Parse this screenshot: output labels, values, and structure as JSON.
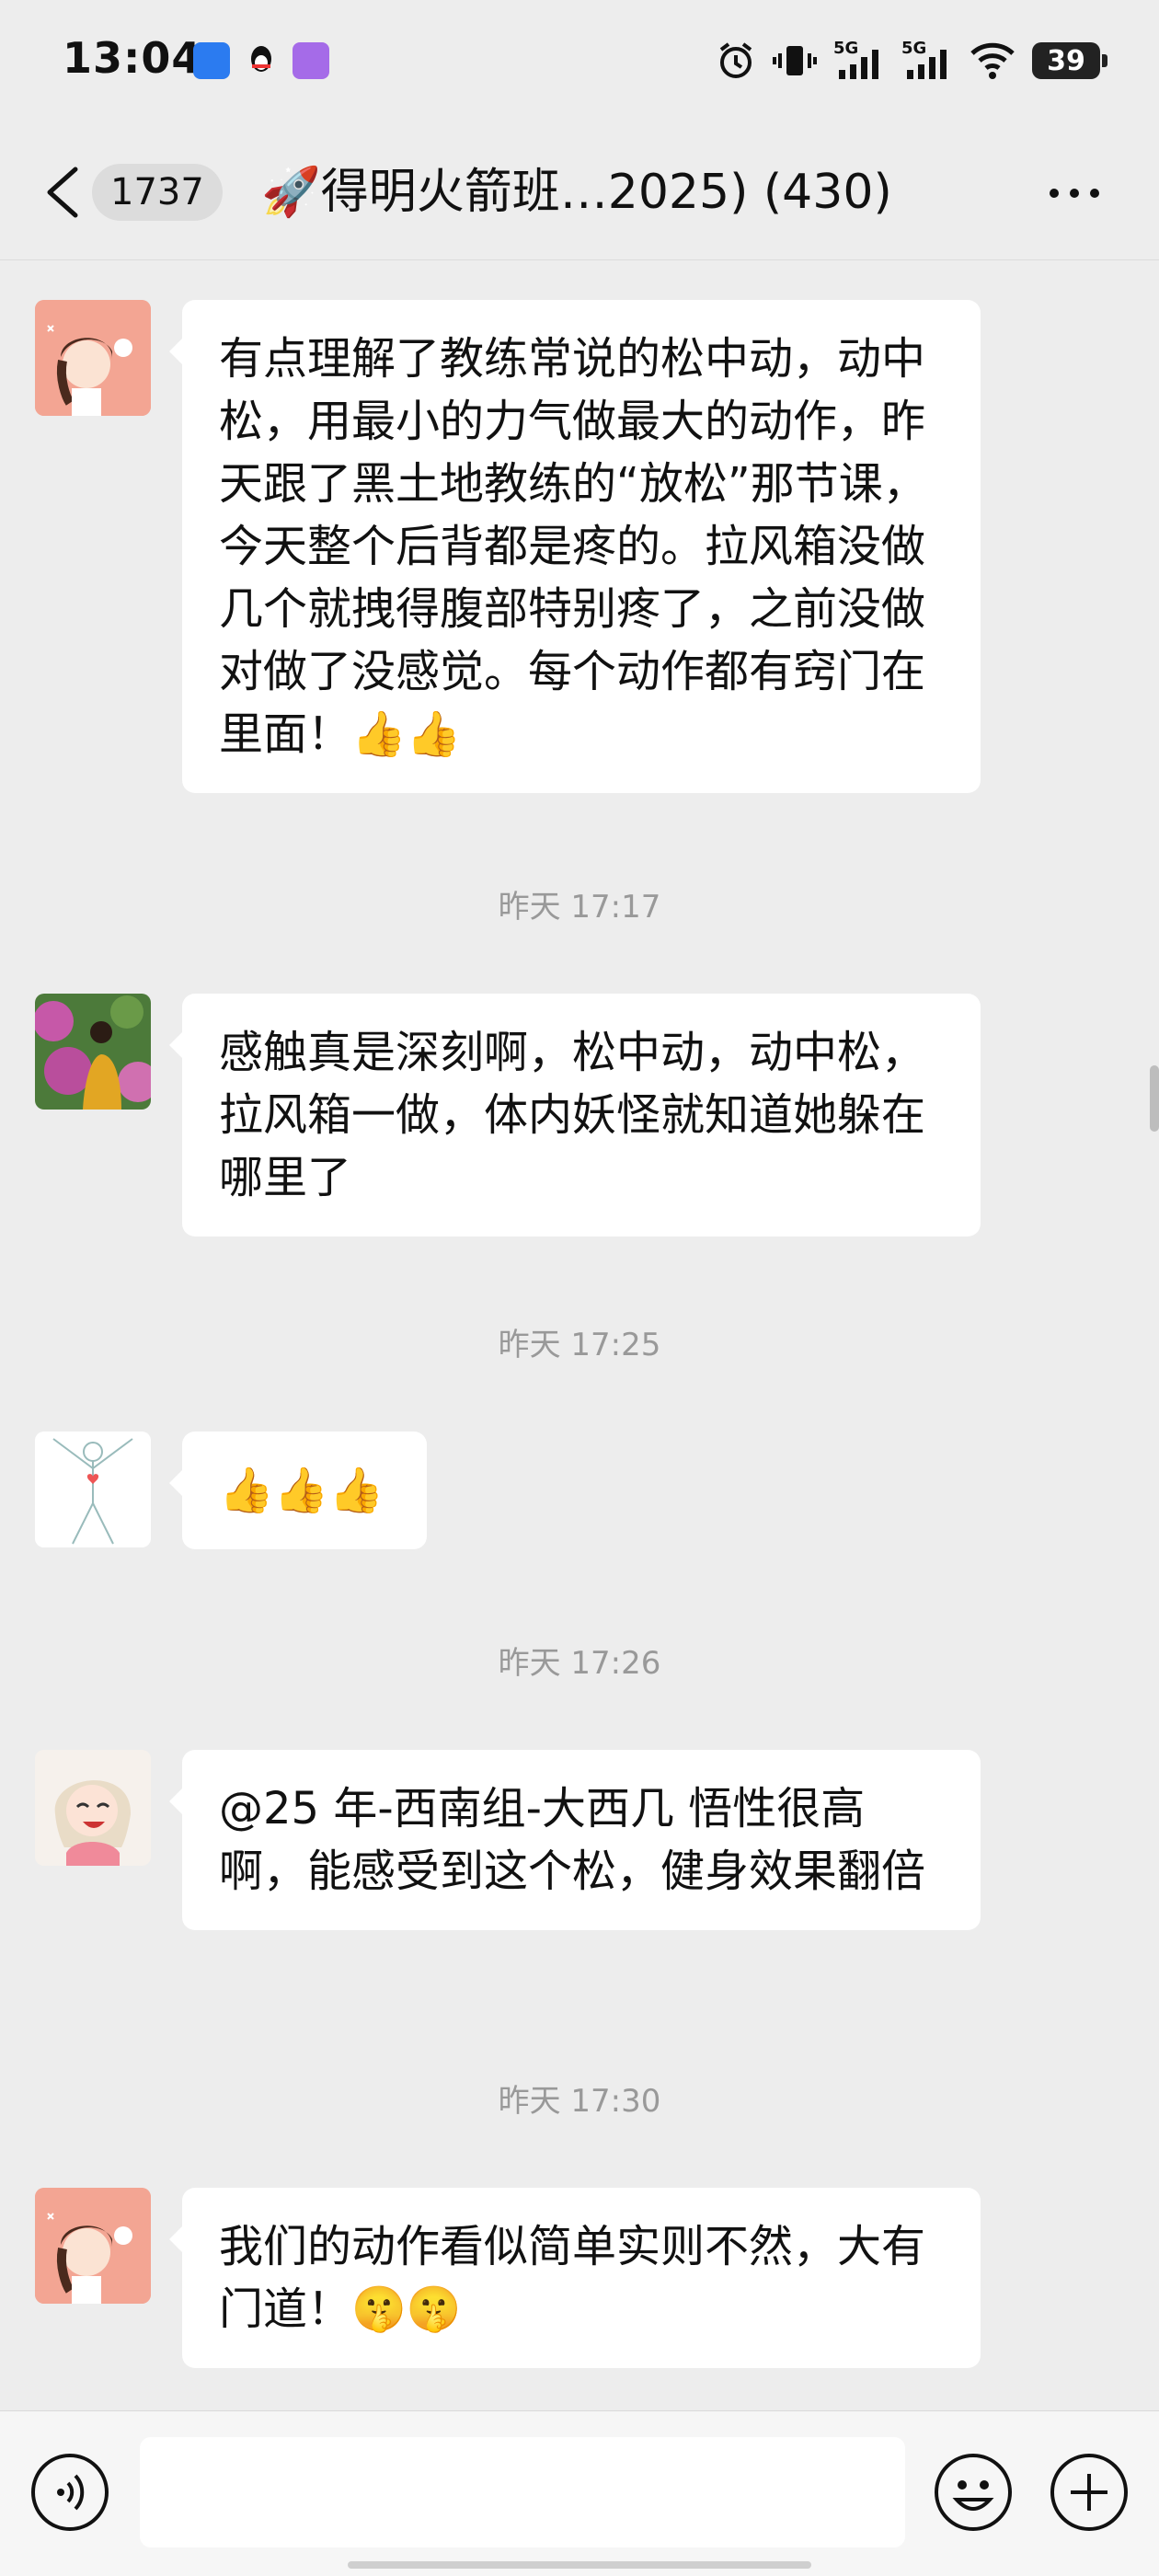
{
  "status_bar": {
    "time": "13:04",
    "app_icons": [
      "message-app-icon",
      "qq-icon",
      "app-icon"
    ],
    "network": [
      "5G",
      "5G"
    ],
    "battery": "39"
  },
  "nav": {
    "unread_count": "1737",
    "title": "🚀得明火箭班…2025) (430)"
  },
  "messages": [
    {
      "text": "有点理解了教练常说的松中动，动中松，用最小的力气做最大的动作，昨天跟了黑土地教练的“放松”那节课，今天整个后背都是疼的。拉风箱没做几个就拽得腹部特别疼了，之前没做对做了没感觉。每个动作都有窍门在里面！👍👍"
    },
    {
      "time": "昨天 17:17"
    },
    {
      "text": "感触真是深刻啊，松中动，动中松，拉风箱一做，体内妖怪就知道她躲在哪里了"
    },
    {
      "time": "昨天 17:25"
    },
    {
      "text": "👍👍👍"
    },
    {
      "time": "昨天 17:26"
    },
    {
      "text": "@25 年-西南组-大西几  悟性很高啊，能感受到这个松，健身效果翻倍"
    },
    {
      "time": "昨天 17:30"
    },
    {
      "text": "我们的动作看似简单实则不然，大有门道！🤫🤫"
    }
  ],
  "input_bar": {
    "placeholder": ""
  }
}
